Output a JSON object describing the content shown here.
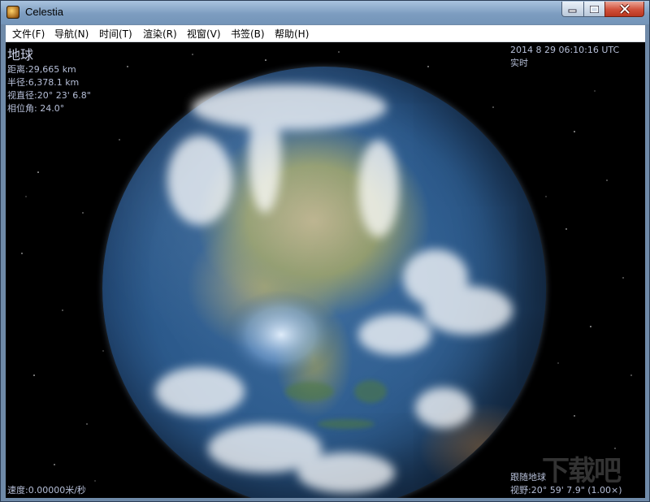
{
  "window": {
    "title": "Celestia"
  },
  "menu": [
    {
      "label": "文件(F)"
    },
    {
      "label": "导航(N)"
    },
    {
      "label": "时间(T)"
    },
    {
      "label": "渲染(R)"
    },
    {
      "label": "视窗(V)"
    },
    {
      "label": "书签(B)"
    },
    {
      "label": "帮助(H)"
    }
  ],
  "hud": {
    "object_name": "地球",
    "distance": "距离:29,665 km",
    "radius": "半径:6,378.1 km",
    "apparent_diameter": "视直径:20° 23' 6.8\"",
    "phase_angle": "相位角: 24.0°",
    "datetime": "2014 8 29 06:10:16 UTC",
    "time_mode": "实时",
    "speed": "速度:0.00000米/秒",
    "follow": "跟随地球",
    "fov": "视野:20° 59' 7.9\" (1.00×)"
  },
  "watermark": "下载吧",
  "colors": {
    "hud_text": "#b6bfd8",
    "titlebar": "#7d9dc0",
    "close_button": "#c9412b"
  },
  "icons": {
    "app": "celestia-icon",
    "minimize": "minimize-icon",
    "maximize": "maximize-icon",
    "close": "close-icon"
  }
}
